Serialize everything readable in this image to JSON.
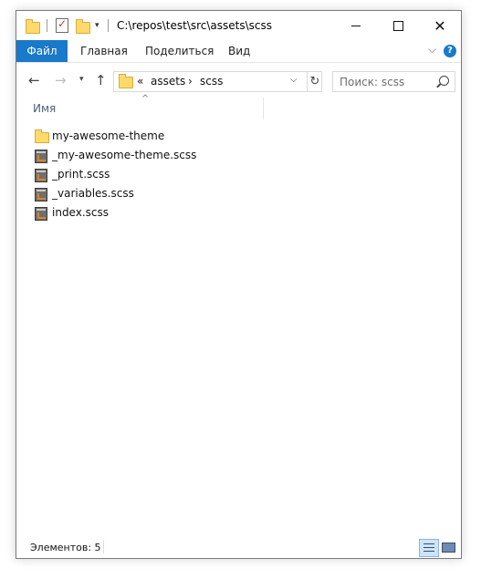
{
  "window": {
    "title": "C:\\repos\\test\\src\\assets\\scss"
  },
  "ribbon": {
    "tabs": [
      {
        "label": "Файл"
      },
      {
        "label": "Главная"
      },
      {
        "label": "Поделиться"
      },
      {
        "label": "Вид"
      }
    ]
  },
  "navigation": {
    "breadcrumb": [
      "assets",
      "scss"
    ],
    "overflow_glyph": "«",
    "search_placeholder": "Поиск: scss"
  },
  "columns": {
    "name": "Имя"
  },
  "files": [
    {
      "name": "my-awesome-theme",
      "icon": "folder-icon"
    },
    {
      "name": "_my-awesome-theme.scss",
      "icon": "scss-file-icon"
    },
    {
      "name": "_print.scss",
      "icon": "scss-file-icon"
    },
    {
      "name": "_variables.scss",
      "icon": "scss-file-icon"
    },
    {
      "name": "index.scss",
      "icon": "scss-file-icon"
    }
  ],
  "status": {
    "item_count": "Элементов: 5"
  },
  "colors": {
    "accent": "#1979ca",
    "folder": "#ffd96b",
    "column_header_text": "#4c607a"
  }
}
